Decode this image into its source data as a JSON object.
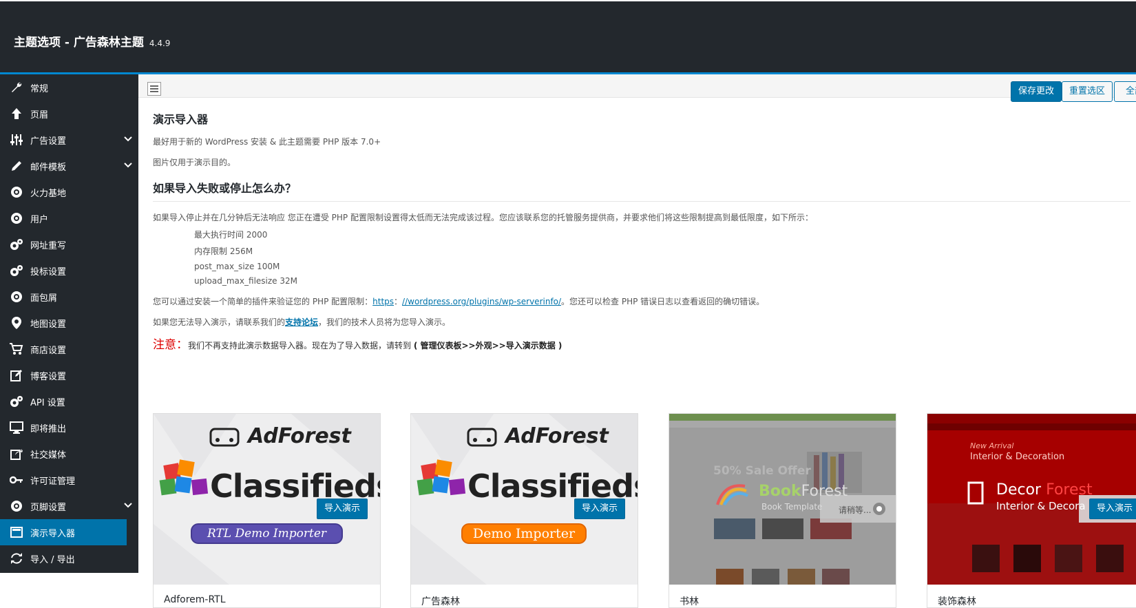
{
  "header": {
    "title": "主题选项 - 广告森林主题",
    "version": "4.4.9"
  },
  "sidebar": {
    "items": [
      {
        "label": "常规",
        "icon": "wrench-icon"
      },
      {
        "label": "页眉",
        "icon": "arrow-up-icon"
      },
      {
        "label": "广告设置",
        "icon": "sliders-icon",
        "expandable": true
      },
      {
        "label": "邮件模板",
        "icon": "pencil-icon",
        "expandable": true
      },
      {
        "label": "火力基地",
        "icon": "cog-circle-icon"
      },
      {
        "label": "用户",
        "icon": "cog-circle-icon"
      },
      {
        "label": "网址重写",
        "icon": "cogs-icon"
      },
      {
        "label": "投标设置",
        "icon": "cogs-icon"
      },
      {
        "label": "面包屑",
        "icon": "cog-circle-icon"
      },
      {
        "label": "地图设置",
        "icon": "map-marker-icon"
      },
      {
        "label": "商店设置",
        "icon": "cart-icon"
      },
      {
        "label": "博客设置",
        "icon": "edit-icon"
      },
      {
        "label": "API 设置",
        "icon": "cogs-icon"
      },
      {
        "label": "即将推出",
        "icon": "monitor-icon"
      },
      {
        "label": "社交媒体",
        "icon": "share-icon"
      },
      {
        "label": "许可证管理",
        "icon": "key-icon"
      },
      {
        "label": "页脚设置",
        "icon": "cog-circle-icon",
        "expandable": true
      },
      {
        "label": "演示导入器",
        "icon": "window-icon",
        "active": true
      },
      {
        "label": "导入 / 导出",
        "icon": "refresh-icon"
      }
    ]
  },
  "toolbar": {
    "save_label": "保存更改",
    "reset_section_label": "重置选区",
    "reset_all_label": "全部"
  },
  "main": {
    "title": "演示导入器",
    "intro1": "最好用于新的 WordPress 安装 & 此主题需要 PHP 版本 7.0+",
    "intro2": "图片仅用于演示目的。",
    "faq_title": "如果导入失败或停止怎么办？",
    "faq_text": "如果导入停止并在几分钟后无法响应 您正在遭受 PHP 配置限制设置得太低而无法完成该过程。您应该联系您的托管服务提供商，并要求他们将这些限制提高到最低限度，如下所示：",
    "limits": [
      "最大执行时间 2000",
      "内存限制 256M",
      "post_max_size 100M",
      "upload_max_filesize 32M"
    ],
    "verify_prefix": "您可以通过安装一个简单的插件来验证您的 PHP 配置限制：",
    "verify_link1": "https",
    "verify_colon": "：",
    "verify_link2": "//wordpress.org/plugins/wp-serverinfo/",
    "verify_suffix": "。您还可以检查 PHP 错误日志以查看返回的确切错误。",
    "support_prefix": "如果您无法导入演示，请联系我们的",
    "support_link": "支持论坛",
    "support_suffix": "，我们的技术人员将为您导入演示。",
    "notice_label": "注意：",
    "notice_text": "我们不再支持此演示数据导入器。现在为了导入数据，请转到",
    "notice_path": "( 管理仪表板>>外观>>导入演示数据 )"
  },
  "demos": [
    {
      "name": "Adforem-RTL",
      "brand": "AdForest",
      "sub": "Classifieds",
      "ribbon": "RTL Demo Importer",
      "button": "导入演示"
    },
    {
      "name": "广告森林",
      "brand": "AdForest",
      "sub": "Classifieds",
      "ribbon": "Demo Importer",
      "button": "导入演示"
    },
    {
      "name": "书林",
      "headline": "50% Sale Offer",
      "brand_a": "Book",
      "brand_b": "Forest",
      "tagline": "Book Template",
      "waiting": "请稍等..."
    },
    {
      "name": "装饰森林",
      "kicker": "New Arrival",
      "headline": "Interior & Decoration",
      "brand_a": "Decor",
      "brand_b": "Forest",
      "tagline": "Interior & Decora",
      "button": "导入演示"
    }
  ],
  "colors": {
    "sidebar_bg": "#23282d",
    "accent": "#0073aa",
    "header_border": "#0088d1",
    "notice_red": "#dd0000"
  }
}
